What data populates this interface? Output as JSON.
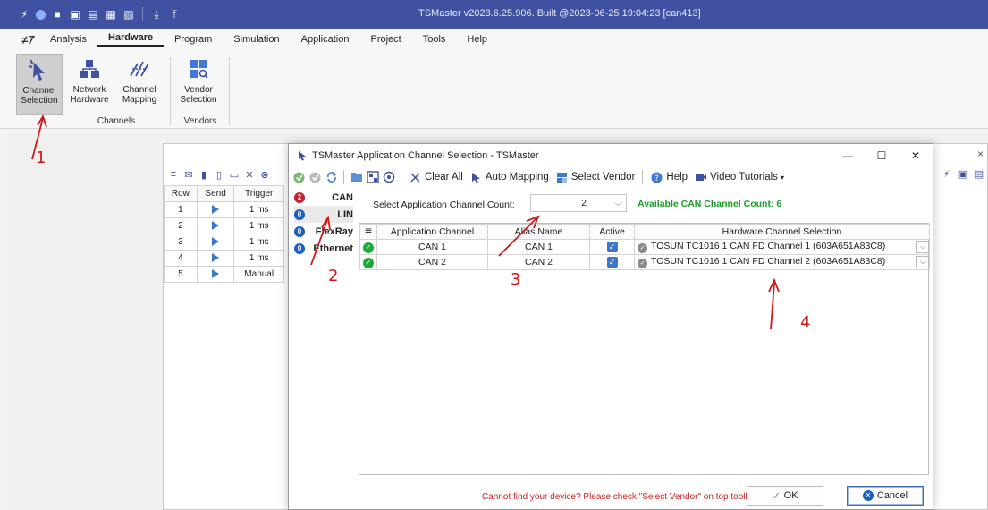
{
  "window": {
    "title": "TSMaster v2023.6.25.906. Built @2023-06-25 19:04:23 [can413]"
  },
  "menu": {
    "logo": "≠7",
    "items": [
      "Analysis",
      "Hardware",
      "Program",
      "Simulation",
      "Application",
      "Project",
      "Tools",
      "Help"
    ],
    "active": "Hardware"
  },
  "ribbon": {
    "buttons": [
      {
        "line1": "Channel",
        "line2": "Selection"
      },
      {
        "line1": "Network",
        "line2": "Hardware"
      },
      {
        "line1": "Channel",
        "line2": "Mapping"
      },
      {
        "line1": "Vendor",
        "line2": "Selection"
      }
    ],
    "groups": [
      "Channels",
      "Vendors"
    ]
  },
  "bg_panel": {
    "close": "×",
    "columns": [
      "Row",
      "Send",
      "Trigger"
    ],
    "rows": [
      {
        "row": "1",
        "trigger": "1 ms"
      },
      {
        "row": "2",
        "trigger": "1 ms"
      },
      {
        "row": "3",
        "trigger": "1 ms"
      },
      {
        "row": "4",
        "trigger": "1 ms"
      },
      {
        "row": "5",
        "trigger": "Manual"
      }
    ]
  },
  "dialog": {
    "title": "TSMaster Application Channel Selection - TSMaster",
    "toolbar": {
      "clear_all": "Clear All",
      "auto_mapping": "Auto Mapping",
      "select_vendor": "Select Vendor",
      "help": "Help",
      "video_tutorials": "Video Tutorials"
    },
    "buses": [
      {
        "badge": "2",
        "label": "CAN",
        "color": "red"
      },
      {
        "badge": "0",
        "label": "LIN",
        "color": "blue"
      },
      {
        "badge": "0",
        "label": "FlexRay",
        "color": "blue"
      },
      {
        "badge": "0",
        "label": "Ethernet",
        "color": "blue"
      }
    ],
    "count_label": "Select Application Channel Count:",
    "count_value": "2",
    "available": "Available CAN Channel Count: 6",
    "grid": {
      "columns": [
        "Application Channel",
        "Alias Name",
        "Active",
        "Hardware Channel Selection"
      ],
      "rows": [
        {
          "app": "CAN 1",
          "alias": "CAN 1",
          "hw": "TOSUN TC1016 1 CAN FD Channel 1 (603A651A83C8)"
        },
        {
          "app": "CAN 2",
          "alias": "CAN 2",
          "hw": "TOSUN TC1016 1 CAN FD Channel 2 (603A651A83C8)"
        }
      ]
    },
    "footer_msg": "Cannot find your device? Please check \"Select Vendor\" on top toolbar",
    "ok": "OK",
    "cancel": "Cancel"
  },
  "annotations": [
    "1",
    "2",
    "3",
    "4"
  ],
  "colors": {
    "titlebar": "#3f51a0",
    "accent_green": "#1e9a2d",
    "warning_red": "#cc1f1f",
    "annotation_red": "#d01818"
  }
}
